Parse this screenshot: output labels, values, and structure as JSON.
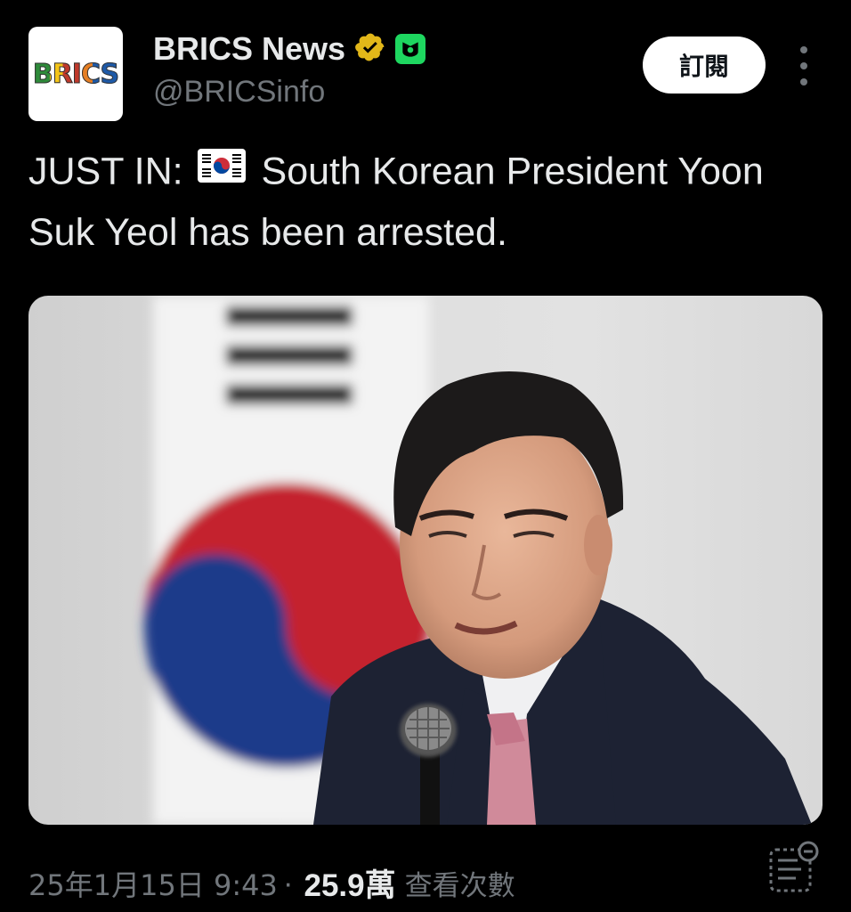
{
  "account": {
    "avatar_text": "BRICS",
    "display_name": "BRICS News",
    "handle": "@BRICSinfo"
  },
  "actions": {
    "subscribe_label": "訂閱"
  },
  "tweet": {
    "text_before_flag": "JUST IN:",
    "text_after_flag": "South Korean President Yoon Suk Yeol has been arrested.",
    "timestamp": "25年1月15日 9:43",
    "separator": "·",
    "views": "25.9萬",
    "views_label": "查看次數"
  },
  "icons": {
    "verified": "verified-gold-badge-icon",
    "affiliate": "affiliate-badge-icon",
    "more": "more-vertical-icon",
    "flag": "south-korea-flag-icon",
    "summary": "summary-icon"
  },
  "colors": {
    "background": "#000000",
    "text": "#e7e9ea",
    "secondary_text": "#71767b",
    "verified_gold": "#e2b719",
    "affiliate_green": "#1ed760",
    "button_bg": "#ffffff"
  }
}
